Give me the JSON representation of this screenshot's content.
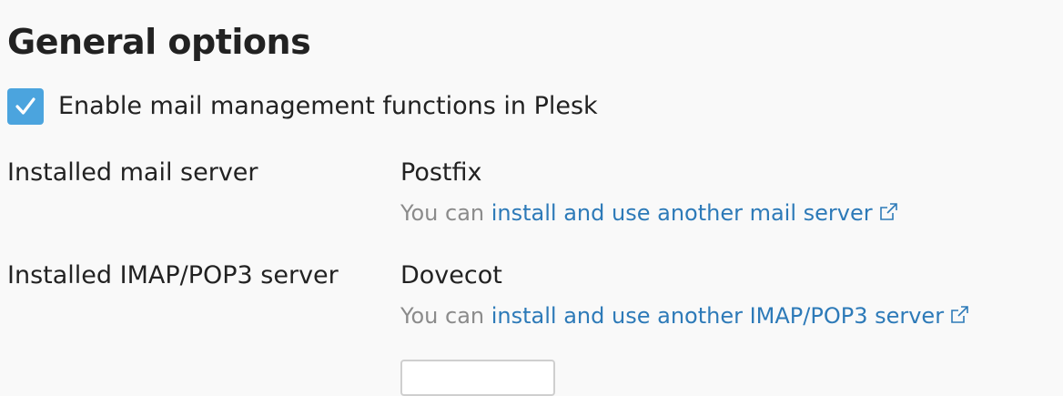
{
  "section": {
    "title": "General options"
  },
  "mail_management": {
    "checked": true,
    "label": "Enable mail management functions in Plesk"
  },
  "mail_server": {
    "label": "Installed mail server",
    "value": "Postfix",
    "hint_prefix": "You can ",
    "hint_link": "install and use another mail server",
    "link_icon": "external-link-icon"
  },
  "imap_server": {
    "label": "Installed IMAP/POP3 server",
    "value": "Dovecot",
    "hint_prefix": "You can ",
    "hint_link": "install and use another IMAP/POP3 server",
    "link_icon": "external-link-icon"
  },
  "colors": {
    "accent": "#4ba4de",
    "link": "#2d7ab8",
    "hint": "#8b8b8b"
  }
}
